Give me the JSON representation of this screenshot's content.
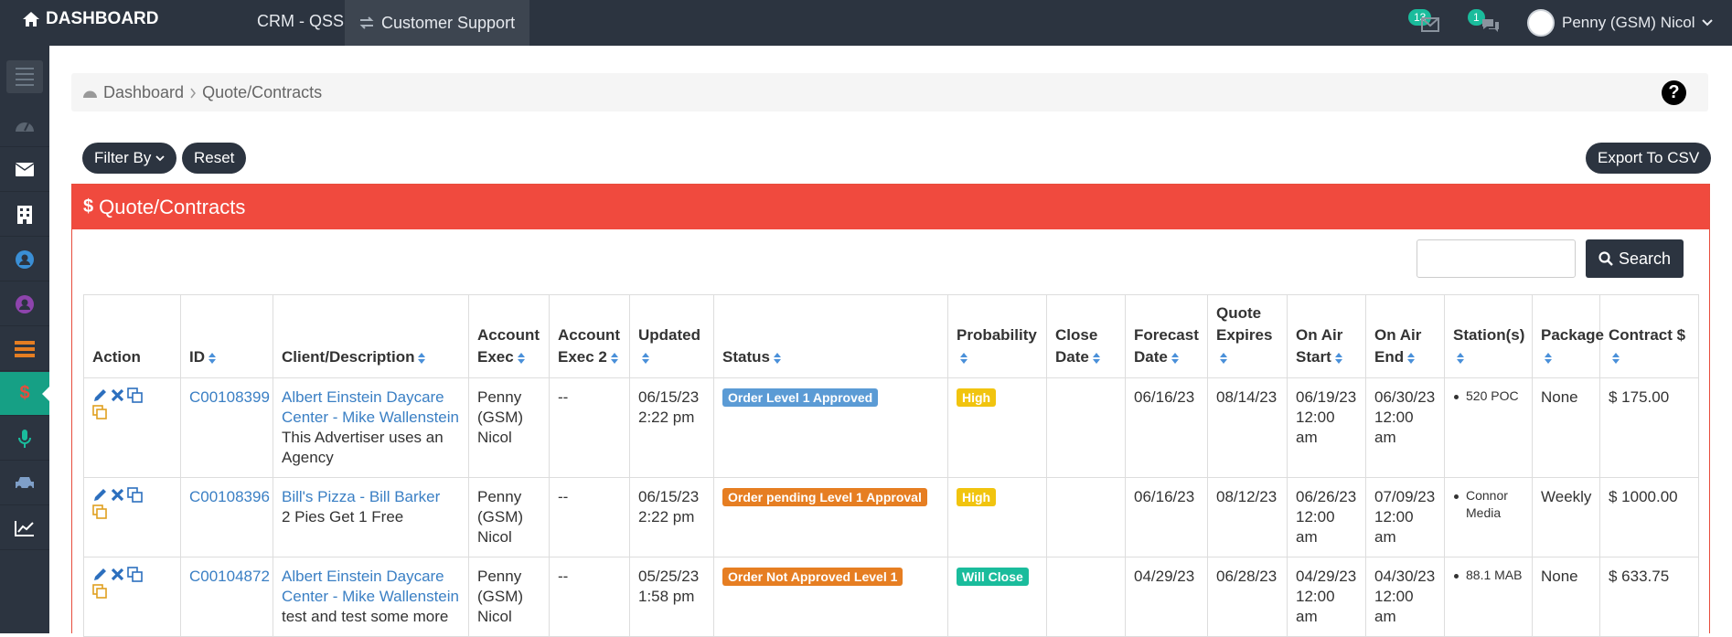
{
  "topbar": {
    "brand": "DASHBOARD",
    "crm": "CRM - QSSS",
    "customer_support": "Customer Support",
    "mail_count": "13",
    "chat_count": "1",
    "user_name": "Penny (GSM) Nicol"
  },
  "sidebar": {
    "items": [
      "menu-icon",
      "dashboard-icon",
      "mail-icon",
      "building-icon",
      "user-circle-icon",
      "user-circle-icon",
      "list-icon",
      "dollar-icon",
      "microphone-icon",
      "car-icon",
      "chart-icon"
    ],
    "active_label": "$"
  },
  "breadcrumb": {
    "home": "Dashboard",
    "current": "Quote/Contracts"
  },
  "toolbar": {
    "filter_label": "Filter By",
    "reset_label": "Reset",
    "export_label": "Export To CSV"
  },
  "panel": {
    "title": "Quote/Contracts",
    "search_placeholder": "",
    "search_label": "Search"
  },
  "table": {
    "headers": [
      "Action",
      "ID",
      "Client/Description",
      "Account Exec",
      "Account Exec 2",
      "Updated",
      "Status",
      "Probability",
      "Close Date",
      "Forecast Date",
      "Quote Expires",
      "On Air Start",
      "On Air End",
      "Station(s)",
      "Package",
      "Contract $"
    ],
    "rows": [
      {
        "id": "C00108399",
        "client": "Albert Einstein Daycare Center - Mike Wallenstein",
        "desc": "This Advertiser uses an Agency",
        "ae": "Penny (GSM) Nicol",
        "ae2": "--",
        "updated": "06/15/23 2:22 pm",
        "status": "Order Level 1 Approved",
        "status_color": "#5b9bd5",
        "probability": "High",
        "prob_color": "#f1c40f",
        "close": "",
        "forecast": "06/16/23",
        "expires": "08/14/23",
        "start": "06/19/23 12:00 am",
        "end": "06/30/23 12:00 am",
        "station": "520 POC",
        "package": "None",
        "contract": "$ 175.00"
      },
      {
        "id": "C00108396",
        "client": "Bill's Pizza - Bill Barker",
        "desc": "2 Pies Get 1 Free",
        "ae": "Penny (GSM) Nicol",
        "ae2": "--",
        "updated": "06/15/23 2:22 pm",
        "status": "Order pending Level 1 Approval",
        "status_color": "#e67e22",
        "probability": "High",
        "prob_color": "#f1c40f",
        "close": "",
        "forecast": "06/16/23",
        "expires": "08/12/23",
        "start": "06/26/23 12:00 am",
        "end": "07/09/23 12:00 am",
        "station": "Connor Media",
        "package": "Weekly",
        "contract": "$ 1000.00"
      },
      {
        "id": "C00104872",
        "client": "Albert Einstein Daycare Center - Mike Wallenstein",
        "desc": "test and test some more",
        "ae": "Penny (GSM) Nicol",
        "ae2": "--",
        "updated": "05/25/23 1:58 pm",
        "status": "Order Not Approved Level 1",
        "status_color": "#e67e22",
        "probability": "Will Close",
        "prob_color": "#1abc9c",
        "close": "",
        "forecast": "04/29/23",
        "expires": "06/28/23",
        "start": "04/29/23 12:00 am",
        "end": "04/30/23 12:00 am",
        "station": "88.1 MAB",
        "package": "None",
        "contract": "$ 633.75"
      }
    ]
  }
}
